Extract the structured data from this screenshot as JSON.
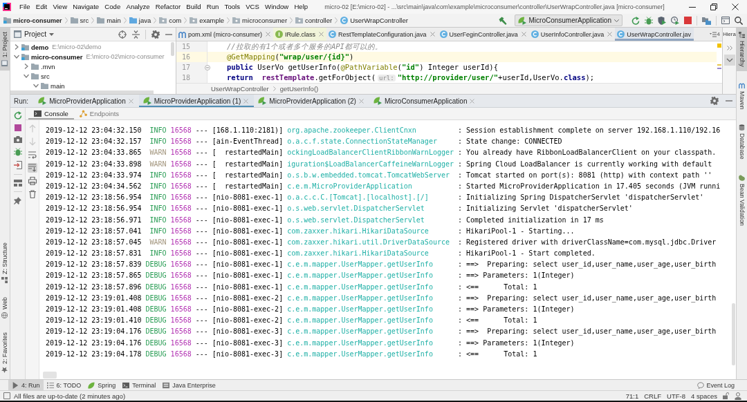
{
  "window": {
    "title": "micro-02 [E:\\micro-02] - ...\\src\\main\\java\\com\\example\\microconsumer\\controller\\UserWrapController.java [micro-consumer]",
    "menu": [
      "File",
      "Edit",
      "View",
      "Navigate",
      "Code",
      "Analyze",
      "Refactor",
      "Build",
      "Run",
      "Tools",
      "VCS",
      "Window",
      "Help"
    ]
  },
  "nav_bar": {
    "breadcrumbs": [
      {
        "label": "micro-consumer",
        "kind": "module"
      },
      {
        "label": "src",
        "kind": "folder"
      },
      {
        "label": "main",
        "kind": "folder"
      },
      {
        "label": "java",
        "kind": "source"
      },
      {
        "label": "com",
        "kind": "package"
      },
      {
        "label": "example",
        "kind": "package"
      },
      {
        "label": "microconsumer",
        "kind": "package"
      },
      {
        "label": "controller",
        "kind": "package"
      },
      {
        "label": "UserWrapController",
        "kind": "class"
      }
    ],
    "run_config": "MicroConsumerApplication"
  },
  "left_strip": {
    "top": [
      {
        "label": "1: Project",
        "kind": "project",
        "selected": true
      }
    ],
    "bottom": [
      {
        "label": "Z: Structure",
        "kind": "structure",
        "selected": false
      },
      {
        "label": "Web",
        "kind": "web",
        "selected": false
      },
      {
        "label": "2: Favorites",
        "kind": "favorites",
        "selected": false
      }
    ]
  },
  "project": {
    "title": "Project",
    "tree": [
      {
        "name": "demo",
        "path": "E:\\micro-02\\demo",
        "kind": "module",
        "expanded": false
      },
      {
        "name": "micro-consumer",
        "path": "E:\\micro-02\\micro-consumer",
        "kind": "module",
        "expanded": true,
        "children": [
          {
            "name": ".mvn",
            "kind": "folder",
            "expanded": false
          },
          {
            "name": "src",
            "kind": "folder",
            "expanded": true,
            "children": [
              {
                "name": "main",
                "kind": "folder",
                "expanded": true
              }
            ]
          }
        ]
      }
    ]
  },
  "editor": {
    "tabs": [
      {
        "label": "pom.xml (micro-consumer)",
        "kind": "maven",
        "selected": false,
        "library": false,
        "closable": true
      },
      {
        "label": "IRule.class",
        "kind": "interface",
        "selected": false,
        "library": true,
        "closable": true
      },
      {
        "label": "RestTemplateConfiguration.java",
        "kind": "class",
        "selected": false,
        "library": false,
        "closable": true
      },
      {
        "label": "UserFeginController.java",
        "kind": "class",
        "selected": false,
        "library": false,
        "closable": true
      },
      {
        "label": "UserInfoController.java",
        "kind": "class",
        "selected": false,
        "library": false,
        "closable": true
      },
      {
        "label": "UserWrapController.jav",
        "kind": "class",
        "selected": true,
        "library": false,
        "closable": false
      }
    ],
    "hidden_tabs": "4",
    "lines": [
      {
        "number": "15",
        "current": false,
        "foldable": false,
        "tokens": [
          {
            "kind": "comment",
            "text": "//拉取的有1个或者多个服务的API都可以的。"
          }
        ]
      },
      {
        "number": "16",
        "current": true,
        "foldable": false,
        "tokens": [
          {
            "kind": "annotation",
            "text": "@GetMapping"
          },
          {
            "kind": "plain",
            "text": "("
          },
          {
            "kind": "string",
            "text": "\"wrap/user/{id}\""
          },
          {
            "kind": "plain",
            "text": ")"
          }
        ]
      },
      {
        "number": "17",
        "current": false,
        "foldable": true,
        "tokens": [
          {
            "kind": "keyword",
            "text": "public"
          },
          {
            "kind": "plain",
            "text": " UserVo getUserInfo("
          },
          {
            "kind": "annotation",
            "text": "@PathVariable"
          },
          {
            "kind": "plain",
            "text": "("
          },
          {
            "kind": "string",
            "text": "\"id\""
          },
          {
            "kind": "plain",
            "text": ") Integer userId){"
          }
        ]
      },
      {
        "number": "18",
        "current": false,
        "foldable": false,
        "tokens": [
          {
            "kind": "keyword",
            "text": "return"
          },
          {
            "kind": "field",
            "text": "  restTemplate"
          },
          {
            "kind": "plain",
            "text": ".getForObject("
          },
          {
            "kind": "hint",
            "text": "url:"
          },
          {
            "kind": "string",
            "text": "\"http://provider/user/\""
          },
          {
            "kind": "plain",
            "text": "+userId,UserVo."
          },
          {
            "kind": "keyword",
            "text": "class"
          },
          {
            "kind": "plain",
            "text": ");"
          }
        ]
      }
    ],
    "breadcrumbs": [
      "UserWrapController",
      "getUserInfo()"
    ]
  },
  "hierarchy_panel": {
    "title": "Hiera"
  },
  "right_strip": [
    {
      "label": "Hierarchy",
      "kind": "hierarchy",
      "selected": true
    },
    {
      "label": "Maven",
      "kind": "maven",
      "selected": false
    },
    {
      "label": "Database",
      "kind": "database",
      "selected": false
    },
    {
      "label": "Bean Validation",
      "kind": "bean",
      "selected": false
    }
  ],
  "run": {
    "label": "Run:",
    "tabs": [
      {
        "label": "MicroProviderApplication",
        "selected": false
      },
      {
        "label": "MicroProviderApplication (1)",
        "selected": true
      },
      {
        "label": "MicroProviderApplication (2)",
        "selected": false
      },
      {
        "label": "MicroConsumerApplication",
        "selected": false
      }
    ],
    "subtabs": [
      {
        "label": "Console",
        "kind": "console",
        "selected": true
      },
      {
        "label": "Endpoints",
        "kind": "endpoints",
        "selected": false
      }
    ],
    "console_toolbar": [
      {
        "kind": "up",
        "disabled": true,
        "on": false
      },
      {
        "kind": "down",
        "disabled": true,
        "on": false
      },
      {
        "kind": "wrap",
        "disabled": false,
        "on": false
      },
      {
        "kind": "scroll-end",
        "disabled": false,
        "on": true
      },
      {
        "kind": "print",
        "disabled": false,
        "on": false
      },
      {
        "kind": "clear",
        "disabled": false,
        "on": false
      }
    ],
    "log": [
      {
        "time": "2019-12-12 23:04:32.150",
        "level": "INFO",
        "kind": "info",
        "pid": "16568",
        "thread": "--- [168.1.110:2181)]",
        "logger": "org.apache.zookeeper.ClientCnxn",
        "message": ": Session establishment complete on server 192.168.1.110/192.16"
      },
      {
        "time": "2019-12-12 23:04:32.157",
        "level": "INFO",
        "kind": "info",
        "pid": "16568",
        "thread": "--- [ain-EventThread]",
        "logger": "o.a.c.f.state.ConnectionStateManager",
        "message": ": State change: CONNECTED"
      },
      {
        "time": "2019-12-12 23:04:33.865",
        "level": "WARN",
        "kind": "warn",
        "pid": "16568",
        "thread": "--- [  restartedMain]",
        "logger": "ockingLoadBalancerClientRibbonWarnLogger",
        "message": ": You already have RibbonLoadBalancerClient on your classpath."
      },
      {
        "time": "2019-12-12 23:04:33.898",
        "level": "WARN",
        "kind": "warn",
        "pid": "16568",
        "thread": "--- [  restartedMain]",
        "logger": "iguration$LoadBalancerCaffeineWarnLogger",
        "message": ": Spring Cloud LoadBalancer is currently working with default"
      },
      {
        "time": "2019-12-12 23:04:33.974",
        "level": "INFO",
        "kind": "info",
        "pid": "16568",
        "thread": "--- [  restartedMain]",
        "logger": "o.s.b.w.embedded.tomcat.TomcatWebServer",
        "message": ": Tomcat started on port(s): 8081 (http) with context path ''"
      },
      {
        "time": "2019-12-12 23:04:34.562",
        "level": "INFO",
        "kind": "info",
        "pid": "16568",
        "thread": "--- [  restartedMain]",
        "logger": "c.e.m.MicroProviderApplication",
        "message": ": Started MicroProviderApplication in 17.405 seconds (JVM runni"
      },
      {
        "time": "2019-12-12 23:18:56.954",
        "level": "INFO",
        "kind": "info",
        "pid": "16568",
        "thread": "--- [nio-8081-exec-1]",
        "logger": "o.a.c.c.C.[Tomcat].[localhost].[/]",
        "message": ": Initializing Spring DispatcherServlet 'dispatcherServlet'"
      },
      {
        "time": "2019-12-12 23:18:56.954",
        "level": "INFO",
        "kind": "info",
        "pid": "16568",
        "thread": "--- [nio-8081-exec-1]",
        "logger": "o.s.web.servlet.DispatcherServlet",
        "message": ": Initializing Servlet 'dispatcherServlet'"
      },
      {
        "time": "2019-12-12 23:18:56.971",
        "level": "INFO",
        "kind": "info",
        "pid": "16568",
        "thread": "--- [nio-8081-exec-1]",
        "logger": "o.s.web.servlet.DispatcherServlet",
        "message": ": Completed initialization in 17 ms"
      },
      {
        "time": "2019-12-12 23:18:57.041",
        "level": "INFO",
        "kind": "info",
        "pid": "16568",
        "thread": "--- [nio-8081-exec-1]",
        "logger": "com.zaxxer.hikari.HikariDataSource",
        "message": ": HikariPool-1 - Starting..."
      },
      {
        "time": "2019-12-12 23:18:57.045",
        "level": "WARN",
        "kind": "warn",
        "pid": "16568",
        "thread": "--- [nio-8081-exec-1]",
        "logger": "com.zaxxer.hikari.util.DriverDataSource",
        "message": ": Registered driver with driverClassName=com.mysql.jdbc.Driver"
      },
      {
        "time": "2019-12-12 23:18:57.831",
        "level": "INFO",
        "kind": "info",
        "pid": "16568",
        "thread": "--- [nio-8081-exec-1]",
        "logger": "com.zaxxer.hikari.HikariDataSource",
        "message": ": HikariPool-1 - Start completed."
      },
      {
        "time": "2019-12-12 23:18:57.839",
        "level": "DEBUG",
        "kind": "debug",
        "pid": "16568",
        "thread": "--- [nio-8081-exec-1]",
        "logger": "c.e.m.mapper.UserMapper.getUserInfo",
        "message": ": ==>  Preparing: select user_id,user_name,user_age,user_birth"
      },
      {
        "time": "2019-12-12 23:18:57.865",
        "level": "DEBUG",
        "kind": "debug",
        "pid": "16568",
        "thread": "--- [nio-8081-exec-1]",
        "logger": "c.e.m.mapper.UserMapper.getUserInfo",
        "message": ": ==> Parameters: 1(Integer)"
      },
      {
        "time": "2019-12-12 23:18:57.896",
        "level": "DEBUG",
        "kind": "debug",
        "pid": "16568",
        "thread": "--- [nio-8081-exec-1]",
        "logger": "c.e.m.mapper.UserMapper.getUserInfo",
        "message": ": <==      Total: 1"
      },
      {
        "time": "2019-12-12 23:19:01.408",
        "level": "DEBUG",
        "kind": "debug",
        "pid": "16568",
        "thread": "--- [nio-8081-exec-2]",
        "logger": "c.e.m.mapper.UserMapper.getUserInfo",
        "message": ": ==>  Preparing: select user_id,user_name,user_age,user_birth"
      },
      {
        "time": "2019-12-12 23:19:01.408",
        "level": "DEBUG",
        "kind": "debug",
        "pid": "16568",
        "thread": "--- [nio-8081-exec-2]",
        "logger": "c.e.m.mapper.UserMapper.getUserInfo",
        "message": ": ==> Parameters: 1(Integer)"
      },
      {
        "time": "2019-12-12 23:19:01.410",
        "level": "DEBUG",
        "kind": "debug",
        "pid": "16568",
        "thread": "--- [nio-8081-exec-2]",
        "logger": "c.e.m.mapper.UserMapper.getUserInfo",
        "message": ": <==      Total: 1"
      },
      {
        "time": "2019-12-12 23:19:04.176",
        "level": "DEBUG",
        "kind": "debug",
        "pid": "16568",
        "thread": "--- [nio-8081-exec-3]",
        "logger": "c.e.m.mapper.UserMapper.getUserInfo",
        "message": ": ==>  Preparing: select user_id,user_name,user_age,user_birth"
      },
      {
        "time": "2019-12-12 23:19:04.176",
        "level": "DEBUG",
        "kind": "debug",
        "pid": "16568",
        "thread": "--- [nio-8081-exec-3]",
        "logger": "c.e.m.mapper.UserMapper.getUserInfo",
        "message": ": ==> Parameters: 1(Integer)"
      },
      {
        "time": "2019-12-12 23:19:04.178",
        "level": "DEBUG",
        "kind": "debug",
        "pid": "16568",
        "thread": "--- [nio-8081-exec-3]",
        "logger": "c.e.m.mapper.UserMapper.getUserInfo",
        "message": ": <==      Total: 1"
      }
    ]
  },
  "tool_tabs": [
    {
      "label": "4: Run",
      "kind": "run",
      "selected": true
    },
    {
      "label": "6: TODO",
      "kind": "todo",
      "selected": false
    },
    {
      "label": "Spring",
      "kind": "spring",
      "selected": false
    },
    {
      "label": "Terminal",
      "kind": "terminal",
      "selected": false
    },
    {
      "label": "Java Enterprise",
      "kind": "javaee",
      "selected": false
    }
  ],
  "event_log": "Event Log",
  "status_bar": {
    "message": "All files are up-to-date (2 minutes ago)",
    "position": "71:1",
    "line_separator": "CRLF",
    "encoding": "UTF-8",
    "indent": "4 spaces"
  }
}
